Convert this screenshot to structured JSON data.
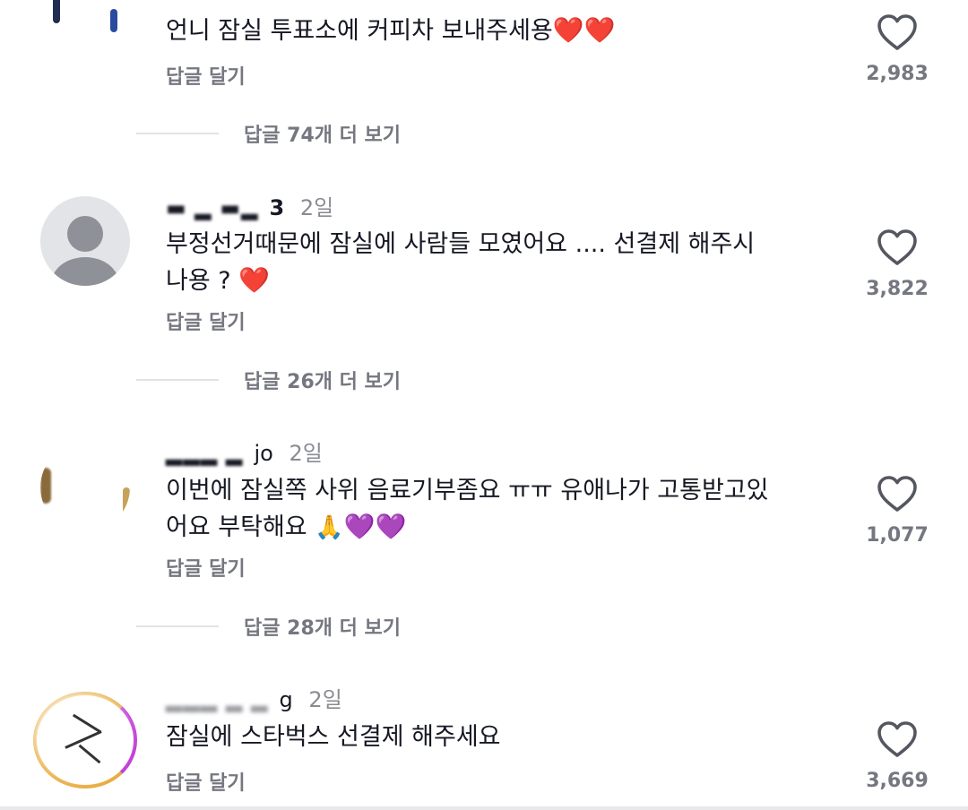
{
  "comments": [
    {
      "username": "",
      "age": "",
      "text_parts": [
        "언니 잠실 투표소에 커피차 보내주세용",
        "❤️❤️"
      ],
      "reply_label": "답글 달기",
      "likes": "2,983",
      "more_replies": "답글 74개 더 보기"
    },
    {
      "username": "3",
      "age": "2일",
      "text_parts": [
        "부정선거때문에 잠실에 사람들 모였어요 .... 선결제 해주시나용 ? ",
        "❤️"
      ],
      "reply_label": "답글 달기",
      "likes": "3,822",
      "more_replies": "답글 26개 더 보기"
    },
    {
      "username": "jo",
      "age": "2일",
      "text_parts": [
        "이번에 잠실쪽 사위 음료기부좀요 ㅠㅠ 유애나가 고통받고있어요 부탁해요 ",
        "🙏",
        "💜💜"
      ],
      "reply_label": "답글 달기",
      "likes": "1,077",
      "more_replies": "답글 28개 더 보기"
    },
    {
      "username": "g",
      "age": "2일",
      "text_parts": [
        "잠실에 스타벅스 선결제 해주세요"
      ],
      "reply_label": "답글 달기",
      "likes": "3,669",
      "more_replies": ""
    }
  ],
  "icons": {
    "like": "heart-outline-icon",
    "default_avatar": "person-placeholder-icon"
  },
  "colors": {
    "heart_emoji": "#e8324e",
    "purple_emoji": "#9b4dff",
    "muted_text": "#757780"
  }
}
